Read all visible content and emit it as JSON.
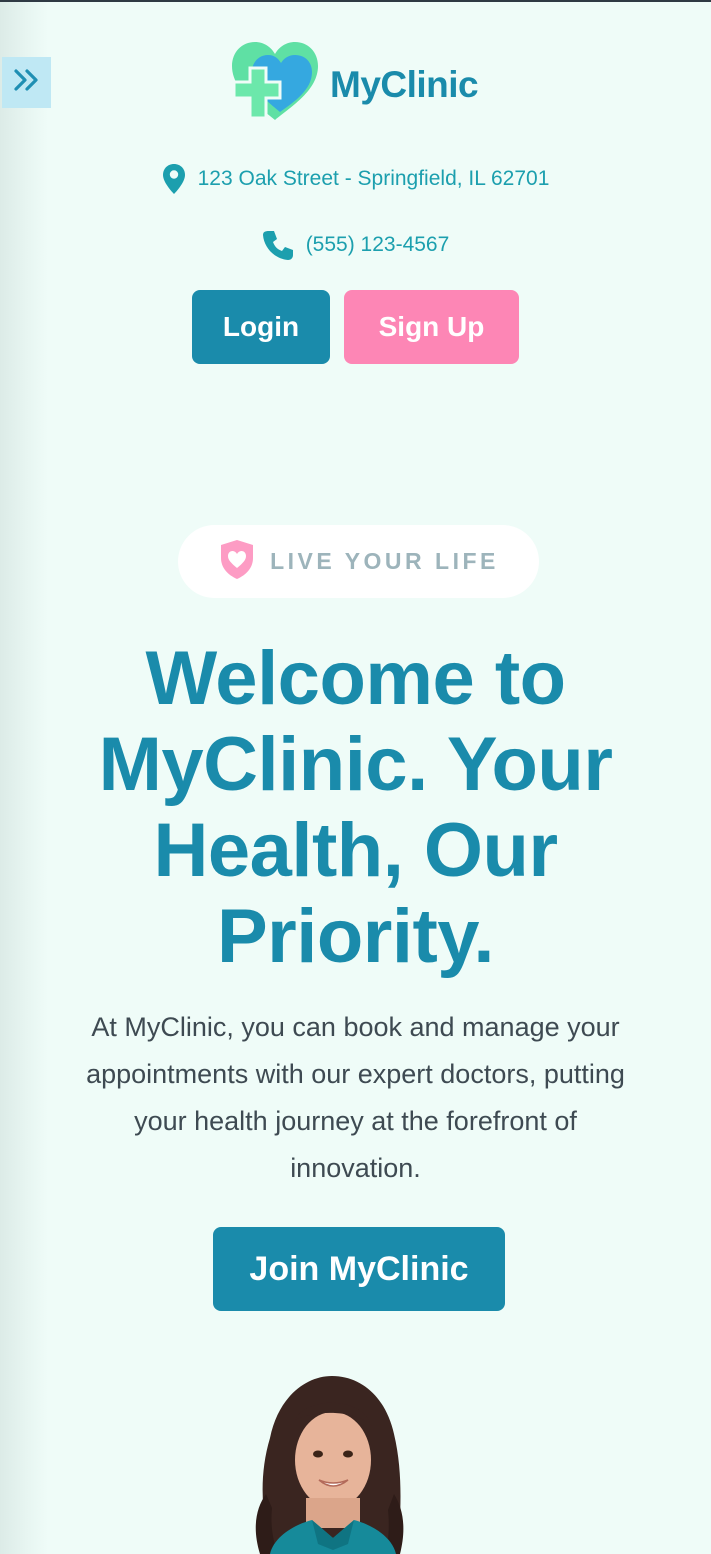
{
  "brand": {
    "name": "MyClinic"
  },
  "contact": {
    "address": "123 Oak Street - Springfield, IL 62701",
    "phone": "(555) 123-4567"
  },
  "auth": {
    "login_label": "Login",
    "signup_label": "Sign Up"
  },
  "hero": {
    "tagline": "LIVE YOUR LIFE",
    "title": "Welcome to MyClinic. Your Health, Our Priority.",
    "description": "At MyClinic, you can book and manage your appointments with our expert doctors, putting your health journey at the forefront of innovation.",
    "cta_label": "Join MyClinic"
  },
  "icons": {
    "sidebar_toggle": "double-chevron-right-icon",
    "address": "map-pin-icon",
    "phone": "phone-icon",
    "tagline": "heart-shield-icon"
  },
  "colors": {
    "background": "#effcf8",
    "primary": "#1a8bab",
    "accent_pink": "#fd86b5",
    "logo_green": "#5fe0a4",
    "logo_blue": "#35a8e0",
    "contact_teal": "#1c9fae",
    "body_text": "#3e4a52",
    "tagline_gray": "#9db4bb"
  }
}
